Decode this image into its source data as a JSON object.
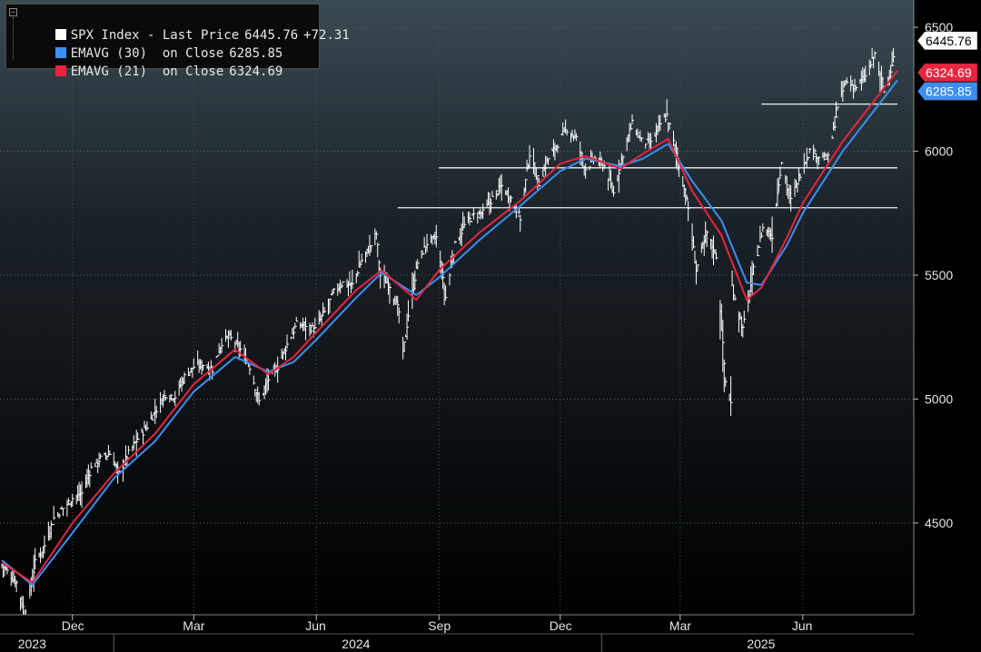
{
  "legend": {
    "rows": [
      {
        "name": "SPX Index - Last Price",
        "value": "6445.76",
        "change": "+72.31",
        "color": "#ffffff"
      },
      {
        "name": "EMAVG (30)  on Close",
        "value": "6285.85",
        "color": "#3d8ef0"
      },
      {
        "name": "EMAVG (21)  on Close",
        "value": "6324.69",
        "color": "#e8253f"
      }
    ]
  },
  "chart_data": {
    "type": "line",
    "title": "",
    "xlabel": "",
    "ylabel": "",
    "ylim": [
      4130,
      6610
    ],
    "y_ticks": [
      4500,
      5000,
      5500,
      6000,
      6500
    ],
    "x_range": [
      "2023-10-09",
      "2025-08-11"
    ],
    "x_month_ticks": [
      {
        "date": "2023-12-01",
        "label": "Dec"
      },
      {
        "date": "2024-03-01",
        "label": "Mar"
      },
      {
        "date": "2024-06-01",
        "label": "Jun"
      },
      {
        "date": "2024-09-01",
        "label": "Sep"
      },
      {
        "date": "2024-12-01",
        "label": "Dec"
      },
      {
        "date": "2025-03-01",
        "label": "Mar"
      },
      {
        "date": "2025-06-01",
        "label": "Jun"
      }
    ],
    "x_year_labels": [
      {
        "date": "2023-11-01",
        "label": "2023"
      },
      {
        "date": "2024-07-01",
        "label": "2024"
      },
      {
        "date": "2025-05-01",
        "label": "2025"
      }
    ],
    "year_boundaries": [
      "2024-01-01",
      "2025-01-01"
    ],
    "grid": true,
    "legend_position": "top-left",
    "series": [
      {
        "name": "SPX Index - Last Price",
        "color": "#ffffff",
        "style": "ohlc-bars",
        "points": [
          [
            "2023-10-09",
            4330
          ],
          [
            "2023-10-20",
            4260
          ],
          [
            "2023-10-27",
            4120
          ],
          [
            "2023-11-03",
            4340
          ],
          [
            "2023-11-10",
            4410
          ],
          [
            "2023-11-17",
            4520
          ],
          [
            "2023-11-24",
            4560
          ],
          [
            "2023-12-01",
            4600
          ],
          [
            "2023-12-08",
            4620
          ],
          [
            "2023-12-15",
            4720
          ],
          [
            "2023-12-22",
            4760
          ],
          [
            "2023-12-29",
            4780
          ],
          [
            "2024-01-05",
            4700
          ],
          [
            "2024-01-12",
            4780
          ],
          [
            "2024-01-19",
            4840
          ],
          [
            "2024-01-26",
            4890
          ],
          [
            "2024-02-02",
            4960
          ],
          [
            "2024-02-09",
            5020
          ],
          [
            "2024-02-16",
            5010
          ],
          [
            "2024-02-23",
            5090
          ],
          [
            "2024-03-01",
            5130
          ],
          [
            "2024-03-08",
            5140
          ],
          [
            "2024-03-15",
            5120
          ],
          [
            "2024-03-22",
            5230
          ],
          [
            "2024-03-28",
            5250
          ],
          [
            "2024-04-05",
            5200
          ],
          [
            "2024-04-12",
            5130
          ],
          [
            "2024-04-19",
            4990
          ],
          [
            "2024-04-26",
            5080
          ],
          [
            "2024-05-03",
            5130
          ],
          [
            "2024-05-10",
            5220
          ],
          [
            "2024-05-17",
            5300
          ],
          [
            "2024-05-24",
            5300
          ],
          [
            "2024-05-31",
            5280
          ],
          [
            "2024-06-07",
            5350
          ],
          [
            "2024-06-14",
            5430
          ],
          [
            "2024-06-21",
            5470
          ],
          [
            "2024-06-28",
            5460
          ],
          [
            "2024-07-05",
            5560
          ],
          [
            "2024-07-12",
            5620
          ],
          [
            "2024-07-16",
            5667
          ],
          [
            "2024-07-19",
            5500
          ],
          [
            "2024-07-26",
            5460
          ],
          [
            "2024-08-02",
            5350
          ],
          [
            "2024-08-05",
            5180
          ],
          [
            "2024-08-09",
            5340
          ],
          [
            "2024-08-16",
            5550
          ],
          [
            "2024-08-23",
            5630
          ],
          [
            "2024-08-30",
            5650
          ],
          [
            "2024-09-06",
            5410
          ],
          [
            "2024-09-13",
            5620
          ],
          [
            "2024-09-20",
            5700
          ],
          [
            "2024-09-27",
            5740
          ],
          [
            "2024-10-04",
            5750
          ],
          [
            "2024-10-11",
            5810
          ],
          [
            "2024-10-18",
            5860
          ],
          [
            "2024-10-25",
            5810
          ],
          [
            "2024-11-01",
            5730
          ],
          [
            "2024-11-08",
            5990
          ],
          [
            "2024-11-15",
            5870
          ],
          [
            "2024-11-22",
            5970
          ],
          [
            "2024-11-29",
            6030
          ],
          [
            "2024-12-06",
            6090
          ],
          [
            "2024-12-13",
            6050
          ],
          [
            "2024-12-20",
            5930
          ],
          [
            "2024-12-27",
            5970
          ],
          [
            "2025-01-03",
            5940
          ],
          [
            "2025-01-10",
            5830
          ],
          [
            "2025-01-17",
            5990
          ],
          [
            "2025-01-24",
            6110
          ],
          [
            "2025-01-31",
            6040
          ],
          [
            "2025-02-07",
            6030
          ],
          [
            "2025-02-14",
            6110
          ],
          [
            "2025-02-19",
            6144
          ],
          [
            "2025-02-28",
            5950
          ],
          [
            "2025-03-07",
            5770
          ],
          [
            "2025-03-13",
            5520
          ],
          [
            "2025-03-21",
            5670
          ],
          [
            "2025-03-28",
            5580
          ],
          [
            "2025-04-04",
            5070
          ],
          [
            "2025-04-08",
            4982
          ],
          [
            "2025-04-09",
            5456
          ],
          [
            "2025-04-17",
            5280
          ],
          [
            "2025-04-25",
            5520
          ],
          [
            "2025-05-02",
            5690
          ],
          [
            "2025-05-09",
            5660
          ],
          [
            "2025-05-16",
            5960
          ],
          [
            "2025-05-23",
            5800
          ],
          [
            "2025-05-30",
            5910
          ],
          [
            "2025-06-06",
            6000
          ],
          [
            "2025-06-13",
            5980
          ],
          [
            "2025-06-20",
            5970
          ],
          [
            "2025-06-27",
            6170
          ],
          [
            "2025-07-03",
            6280
          ],
          [
            "2025-07-11",
            6260
          ],
          [
            "2025-07-18",
            6300
          ],
          [
            "2025-07-25",
            6390
          ],
          [
            "2025-08-01",
            6240
          ],
          [
            "2025-08-06",
            6330
          ],
          [
            "2025-08-11",
            6445.76
          ]
        ]
      },
      {
        "name": "EMAVG (30)  on Close",
        "color": "#3d8ef0",
        "points": [
          [
            "2023-10-09",
            4350
          ],
          [
            "2023-11-01",
            4250
          ],
          [
            "2023-12-01",
            4460
          ],
          [
            "2024-01-01",
            4680
          ],
          [
            "2024-02-01",
            4830
          ],
          [
            "2024-03-01",
            5030
          ],
          [
            "2024-04-01",
            5170
          ],
          [
            "2024-04-26",
            5110
          ],
          [
            "2024-05-15",
            5150
          ],
          [
            "2024-06-01",
            5240
          ],
          [
            "2024-07-01",
            5410
          ],
          [
            "2024-07-20",
            5510
          ],
          [
            "2024-08-15",
            5420
          ],
          [
            "2024-09-01",
            5490
          ],
          [
            "2024-10-01",
            5640
          ],
          [
            "2024-11-01",
            5780
          ],
          [
            "2024-12-01",
            5920
          ],
          [
            "2024-12-20",
            5970
          ],
          [
            "2025-01-15",
            5940
          ],
          [
            "2025-02-01",
            5970
          ],
          [
            "2025-02-20",
            6030
          ],
          [
            "2025-03-10",
            5880
          ],
          [
            "2025-04-01",
            5720
          ],
          [
            "2025-04-20",
            5470
          ],
          [
            "2025-05-01",
            5460
          ],
          [
            "2025-05-20",
            5620
          ],
          [
            "2025-06-01",
            5750
          ],
          [
            "2025-07-01",
            6000
          ],
          [
            "2025-08-11",
            6285.85
          ]
        ]
      },
      {
        "name": "EMAVG (21)  on Close",
        "color": "#e8253f",
        "points": [
          [
            "2023-10-09",
            4340
          ],
          [
            "2023-11-01",
            4260
          ],
          [
            "2023-12-01",
            4500
          ],
          [
            "2024-01-01",
            4700
          ],
          [
            "2024-02-01",
            4860
          ],
          [
            "2024-03-01",
            5060
          ],
          [
            "2024-04-01",
            5200
          ],
          [
            "2024-04-26",
            5100
          ],
          [
            "2024-05-15",
            5170
          ],
          [
            "2024-06-01",
            5270
          ],
          [
            "2024-07-01",
            5440
          ],
          [
            "2024-07-20",
            5520
          ],
          [
            "2024-08-15",
            5400
          ],
          [
            "2024-09-01",
            5520
          ],
          [
            "2024-10-01",
            5670
          ],
          [
            "2024-11-01",
            5800
          ],
          [
            "2024-12-01",
            5950
          ],
          [
            "2024-12-20",
            5980
          ],
          [
            "2025-01-15",
            5930
          ],
          [
            "2025-02-01",
            5990
          ],
          [
            "2025-02-20",
            6050
          ],
          [
            "2025-03-10",
            5840
          ],
          [
            "2025-04-01",
            5660
          ],
          [
            "2025-04-20",
            5400
          ],
          [
            "2025-05-01",
            5450
          ],
          [
            "2025-05-20",
            5650
          ],
          [
            "2025-06-01",
            5790
          ],
          [
            "2025-07-01",
            6040
          ],
          [
            "2025-08-11",
            6324.69
          ]
        ]
      }
    ],
    "horizontal_lines": [
      {
        "y": 6190,
        "from": "2025-05-01",
        "to": "2025-08-11"
      },
      {
        "y": 5933,
        "from": "2024-09-01",
        "to": "2025-08-11"
      },
      {
        "y": 5772,
        "from": "2024-08-01",
        "to": "2025-08-11"
      }
    ],
    "last_value_labels": [
      {
        "text": "6445.76",
        "y": 6445.76,
        "bg": "#ffffff",
        "fg": "#000000"
      },
      {
        "text": "6324.69",
        "y": 6324.69,
        "bg": "#e8253f",
        "fg": "#ffffff"
      },
      {
        "text": "6285.85",
        "y": 6285.85,
        "bg": "#3d8ef0",
        "fg": "#ffffff"
      }
    ]
  }
}
